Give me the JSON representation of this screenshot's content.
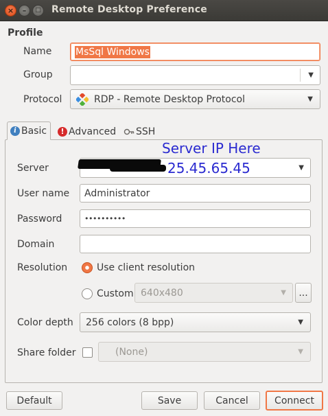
{
  "window": {
    "title": "Remote Desktop Preference",
    "close_glyph": "×",
    "minimize_glyph": "–",
    "maximize_glyph": "□"
  },
  "profile": {
    "section_title": "Profile",
    "name_label": "Name",
    "name_value": "MsSql Windows",
    "group_label": "Group",
    "group_value": "",
    "protocol_label": "Protocol",
    "protocol_value": "RDP - Remote Desktop Protocol"
  },
  "tabs": [
    {
      "label": "Basic",
      "icon": "info-icon",
      "active": true
    },
    {
      "label": "Advanced",
      "icon": "warning-icon",
      "active": false
    },
    {
      "label": "SSH",
      "icon": "key-icon",
      "active": false
    }
  ],
  "basic": {
    "server_label": "Server",
    "server_value": "25.45.65.45",
    "server_annotation": "Server IP Here",
    "username_label": "User name",
    "username_value": "Administrator",
    "password_label": "Password",
    "password_value": "••••••••••",
    "domain_label": "Domain",
    "domain_value": "",
    "resolution_label": "Resolution",
    "resolution_option_client": "Use client resolution",
    "resolution_option_custom": "Custom",
    "custom_resolution_value": "640x480",
    "custom_more_label": "...",
    "color_depth_label": "Color depth",
    "color_depth_value": "256 colors (8 bpp)",
    "share_folder_label": "Share folder",
    "share_folder_value": "(None)"
  },
  "buttons": {
    "default": "Default",
    "save": "Save",
    "cancel": "Cancel",
    "connect": "Connect"
  },
  "colors": {
    "accent": "#f07746",
    "annotation": "#2a2ad0",
    "titlebar": "#3b3a36"
  }
}
